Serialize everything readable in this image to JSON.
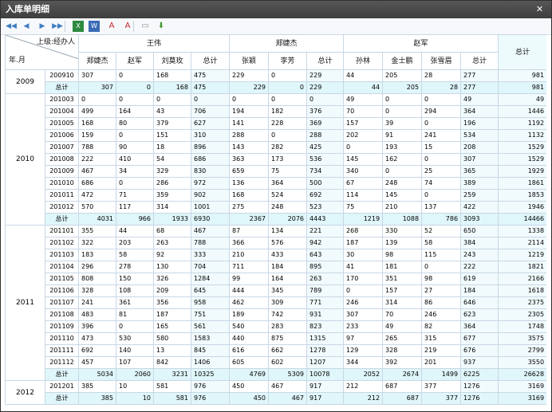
{
  "window": {
    "title": "入库单明细"
  },
  "toolbar": {
    "icons": [
      {
        "name": "first-page-icon",
        "glyph": "◀◀"
      },
      {
        "name": "prev-page-icon",
        "glyph": "◀"
      },
      {
        "name": "next-page-icon",
        "glyph": "▶"
      },
      {
        "name": "last-page-icon",
        "glyph": "▶▶"
      },
      {
        "name": "excel-export-icon",
        "glyph": "X"
      },
      {
        "name": "word-export-icon",
        "glyph": "W"
      },
      {
        "name": "pdf-export-icon",
        "glyph": "A"
      },
      {
        "name": "pdf-export-2-icon",
        "glyph": "A"
      },
      {
        "name": "document-icon",
        "glyph": "▭"
      },
      {
        "name": "download-icon",
        "glyph": "⬇"
      }
    ]
  },
  "header": {
    "corner_top": "上级:经办人",
    "corner_bottom": "年.月",
    "groups": [
      {
        "name": "王伟",
        "members": [
          "郑婕杰",
          "赵军",
          "刘莫玫"
        ]
      },
      {
        "name": "郑婕杰",
        "members": [
          "张颖",
          "李芳"
        ]
      },
      {
        "name": "赵军",
        "members": [
          "孙林",
          "金士鹏",
          "张雪眉"
        ]
      }
    ],
    "subtotal_label": "总计",
    "grand_total_label": "总计"
  },
  "years": [
    {
      "year": "2009",
      "rows": [
        {
          "period": "200910",
          "v": [
            "307",
            "0",
            "168",
            "475",
            "229",
            "0",
            "229",
            "44",
            "205",
            "28",
            "277",
            "981"
          ]
        },
        {
          "period": "总计",
          "subtotal": true,
          "v": [
            "307",
            "0",
            "168",
            "475",
            "229",
            "0",
            "229",
            "44",
            "205",
            "28",
            "277",
            "981"
          ]
        }
      ]
    },
    {
      "year": "2010",
      "rows": [
        {
          "period": "201003",
          "v": [
            "0",
            "0",
            "0",
            "0",
            "0",
            "0",
            "0",
            "49",
            "0",
            "0",
            "49",
            "49"
          ]
        },
        {
          "period": "201004",
          "v": [
            "499",
            "164",
            "43",
            "706",
            "194",
            "182",
            "376",
            "70",
            "0",
            "294",
            "364",
            "1446"
          ]
        },
        {
          "period": "201005",
          "v": [
            "168",
            "80",
            "379",
            "627",
            "141",
            "228",
            "369",
            "157",
            "39",
            "0",
            "196",
            "1192"
          ]
        },
        {
          "period": "201006",
          "v": [
            "159",
            "0",
            "151",
            "310",
            "288",
            "0",
            "288",
            "202",
            "91",
            "241",
            "534",
            "1132"
          ]
        },
        {
          "period": "201007",
          "v": [
            "788",
            "90",
            "18",
            "896",
            "143",
            "282",
            "425",
            "0",
            "193",
            "15",
            "208",
            "1529"
          ]
        },
        {
          "period": "201008",
          "v": [
            "222",
            "410",
            "54",
            "686",
            "363",
            "173",
            "536",
            "145",
            "162",
            "0",
            "307",
            "1529"
          ]
        },
        {
          "period": "201009",
          "v": [
            "467",
            "34",
            "329",
            "830",
            "659",
            "75",
            "734",
            "340",
            "0",
            "25",
            "365",
            "1929"
          ]
        },
        {
          "period": "201010",
          "v": [
            "686",
            "0",
            "286",
            "972",
            "136",
            "364",
            "500",
            "67",
            "248",
            "74",
            "389",
            "1861"
          ]
        },
        {
          "period": "201011",
          "v": [
            "472",
            "71",
            "359",
            "902",
            "168",
            "524",
            "692",
            "114",
            "145",
            "0",
            "259",
            "1853"
          ]
        },
        {
          "period": "201012",
          "v": [
            "570",
            "117",
            "314",
            "1001",
            "275",
            "248",
            "523",
            "75",
            "210",
            "137",
            "422",
            "1946"
          ]
        },
        {
          "period": "总计",
          "subtotal": true,
          "v": [
            "4031",
            "966",
            "1933",
            "6930",
            "2367",
            "2076",
            "4443",
            "1219",
            "1088",
            "786",
            "3093",
            "14466"
          ]
        }
      ]
    },
    {
      "year": "2011",
      "rows": [
        {
          "period": "201101",
          "v": [
            "355",
            "44",
            "68",
            "467",
            "87",
            "134",
            "221",
            "268",
            "330",
            "52",
            "650",
            "1338"
          ]
        },
        {
          "period": "201102",
          "v": [
            "322",
            "203",
            "263",
            "788",
            "366",
            "576",
            "942",
            "187",
            "139",
            "58",
            "384",
            "2114"
          ]
        },
        {
          "period": "201103",
          "v": [
            "183",
            "58",
            "92",
            "333",
            "210",
            "433",
            "643",
            "30",
            "98",
            "115",
            "243",
            "1219"
          ]
        },
        {
          "period": "201104",
          "v": [
            "296",
            "278",
            "130",
            "704",
            "711",
            "184",
            "895",
            "41",
            "181",
            "0",
            "222",
            "1821"
          ]
        },
        {
          "period": "201105",
          "v": [
            "808",
            "150",
            "326",
            "1284",
            "99",
            "164",
            "263",
            "170",
            "351",
            "98",
            "619",
            "2166"
          ]
        },
        {
          "period": "201106",
          "v": [
            "328",
            "108",
            "209",
            "645",
            "444",
            "345",
            "789",
            "0",
            "157",
            "27",
            "184",
            "1618"
          ]
        },
        {
          "period": "201107",
          "v": [
            "241",
            "361",
            "356",
            "958",
            "462",
            "309",
            "771",
            "246",
            "314",
            "86",
            "646",
            "2375"
          ]
        },
        {
          "period": "201108",
          "v": [
            "483",
            "81",
            "187",
            "751",
            "189",
            "742",
            "931",
            "307",
            "70",
            "246",
            "623",
            "2305"
          ]
        },
        {
          "period": "201109",
          "v": [
            "396",
            "0",
            "165",
            "561",
            "540",
            "283",
            "823",
            "233",
            "49",
            "82",
            "364",
            "1748"
          ]
        },
        {
          "period": "201110",
          "v": [
            "473",
            "530",
            "580",
            "1583",
            "440",
            "875",
            "1315",
            "97",
            "265",
            "315",
            "677",
            "3575"
          ]
        },
        {
          "period": "201111",
          "v": [
            "692",
            "140",
            "13",
            "845",
            "616",
            "662",
            "1278",
            "129",
            "328",
            "219",
            "676",
            "2799"
          ]
        },
        {
          "period": "201112",
          "v": [
            "457",
            "107",
            "842",
            "1406",
            "605",
            "602",
            "1207",
            "344",
            "392",
            "201",
            "937",
            "3550"
          ]
        },
        {
          "period": "总计",
          "subtotal": true,
          "v": [
            "5034",
            "2060",
            "3231",
            "10325",
            "4769",
            "5309",
            "10078",
            "2052",
            "2674",
            "1499",
            "6225",
            "26628"
          ]
        }
      ]
    },
    {
      "year": "2012",
      "rows": [
        {
          "period": "201201",
          "v": [
            "385",
            "10",
            "581",
            "976",
            "450",
            "467",
            "917",
            "212",
            "687",
            "377",
            "1276",
            "3169"
          ]
        },
        {
          "period": "总计",
          "subtotal": true,
          "v": [
            "385",
            "10",
            "581",
            "976",
            "450",
            "467",
            "917",
            "212",
            "687",
            "377",
            "1276",
            "3169"
          ]
        }
      ]
    }
  ]
}
